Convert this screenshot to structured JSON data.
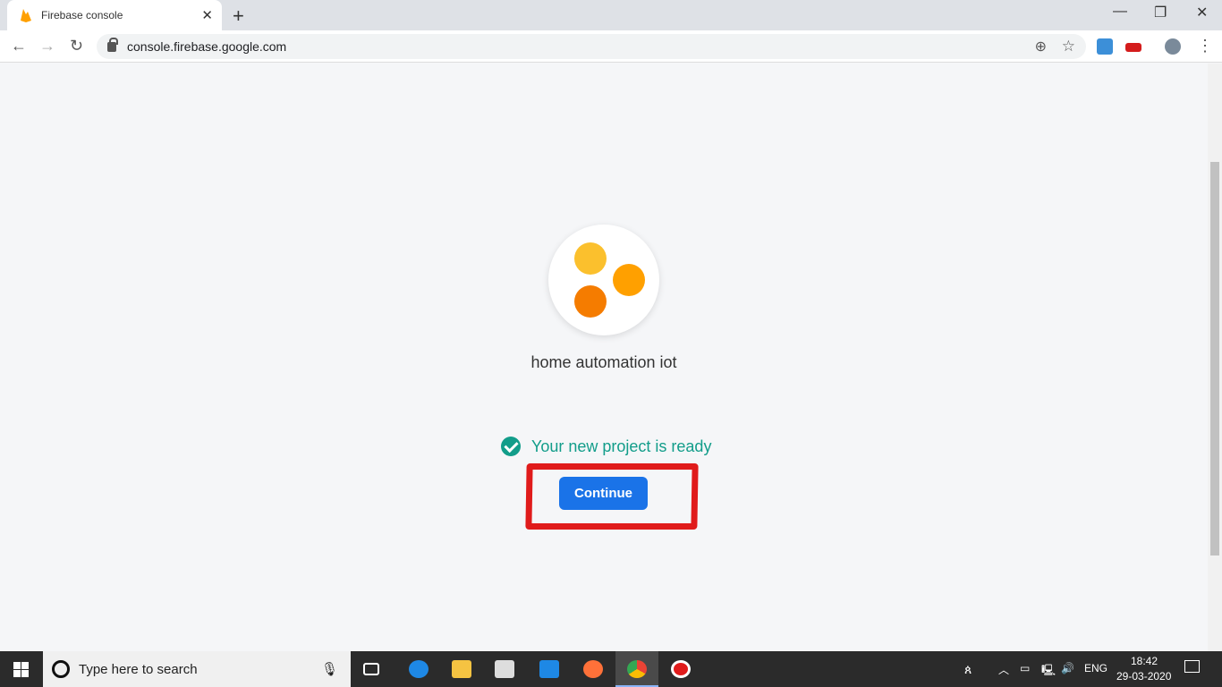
{
  "browser": {
    "tab_title": "Firebase console",
    "tab_close": "✕",
    "new_tab": "+",
    "url": "console.firebase.google.com",
    "back": "←",
    "forward": "→",
    "reload": "↻",
    "zoom": "⊕",
    "star": "☆",
    "menu": "⋮",
    "minimize": "—",
    "restore": "❐",
    "close": "✕"
  },
  "page": {
    "project_name": "home automation iot",
    "status": "Your new project is ready",
    "continue_label": "Continue",
    "colors": {
      "accent": "#1a73e8",
      "success": "#129d8a",
      "dot1": "#fbc02d",
      "dot2": "#ffa000",
      "dot3": "#f57c00",
      "annotation": "#e01b1b"
    }
  },
  "taskbar": {
    "search_placeholder": "Type here to search",
    "language": "ENG",
    "time": "18:42",
    "date": "29-03-2020",
    "icons": [
      "windows-start",
      "cortana",
      "microphone",
      "task-view",
      "edge",
      "file-explorer",
      "store",
      "mail",
      "firefox",
      "chrome",
      "recorder"
    ]
  }
}
